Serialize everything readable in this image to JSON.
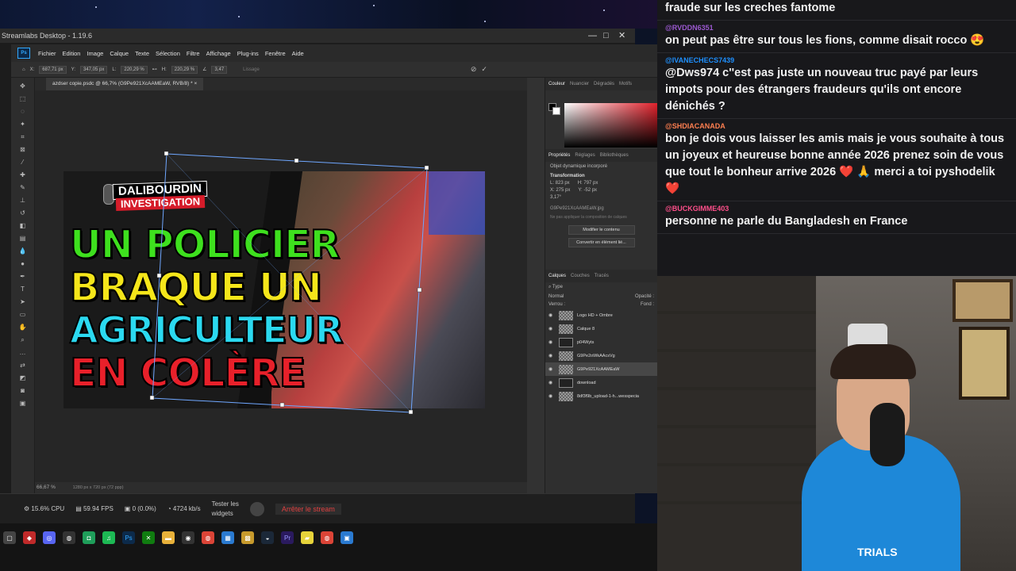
{
  "obs": {
    "title": "Streamlabs Desktop - 1.19.6",
    "min": "—",
    "max": "□",
    "close": "✕"
  },
  "ps": {
    "menu": [
      "Fichier",
      "Edition",
      "Image",
      "Calque",
      "Texte",
      "Sélection",
      "Filtre",
      "Affichage",
      "Plug-ins",
      "Fenêtre",
      "Aide"
    ],
    "options": {
      "x": "687,71 px",
      "y": "347,05 px",
      "w": "220,29 %",
      "h": "220,29 %",
      "angle": "3,47",
      "interp": "Lissage"
    },
    "doc_tab": "azdser copie.psdc @ 66,7% (G9Pe921XcAAMEaW, RVB/8) *",
    "zoom": "66,67 %",
    "doc_size": "1280 px x 720 px (72 ppp)",
    "thumbnail": {
      "badge_top": "DALIBOURDIN",
      "badge_bottom": "INVESTIGATION",
      "headline": [
        {
          "text": "UN POLICIER",
          "color": "#3ee01e"
        },
        {
          "text": "BRAQUE UN",
          "color": "#f5e61a"
        },
        {
          "text": "AGRICULTEUR",
          "color": "#2bd9f0"
        },
        {
          "text": "EN COLÈRE",
          "color": "#e8202a"
        }
      ]
    },
    "color_tabs": [
      "Couleur",
      "Nuancier",
      "Dégradés",
      "Motifs"
    ],
    "props_tabs": [
      "Propriétés",
      "Réglages",
      "Bibliothèques"
    ],
    "props": {
      "kind": "Objet dynamique incorporé",
      "transform": "Transformation",
      "L": "823 px",
      "H": "797 px",
      "X": "275 px",
      "Y": "-52 px",
      "angle": "3,17°",
      "filename": "G9Pe921XcAAMEaW.jpg",
      "comp": "Ne pas appliquer la composition de calques",
      "btn_edit": "Modifier le contenu",
      "btn_convert": "Convertir en élément lié..."
    },
    "layer_tabs": [
      "Calques",
      "Couches",
      "Tracés"
    ],
    "layer_search": "Type",
    "blend": "Normal",
    "opacity_label": "Opacité :",
    "lock_label": "Verrou :",
    "fill_label": "Fond :",
    "layers": [
      {
        "name": "Logo HD + Ombre",
        "dark": false,
        "sel": false
      },
      {
        "name": "Calque 8",
        "dark": false,
        "sel": false
      },
      {
        "name": "p04Wyts",
        "dark": true,
        "sel": false
      },
      {
        "name": "G9Pe2oWkAAcsVg",
        "dark": false,
        "sel": false
      },
      {
        "name": "G9Pe921XcAAMEaW",
        "dark": false,
        "sel": true
      },
      {
        "name": "download",
        "dark": true,
        "sel": false
      },
      {
        "name": "8df3f9b_upload-1-h...wesspecia",
        "dark": false,
        "sel": false
      }
    ]
  },
  "bottom": {
    "cpu": "15.6% CPU",
    "fps": "59.94 FPS",
    "dropped": "0 (0.0%)",
    "bitrate": "4724 kb/s",
    "test_widgets_1": "Tester les",
    "test_widgets_2": "widgets",
    "stop": "Arrêter le stream"
  },
  "chat": [
    {
      "user": "",
      "color": "#a970ff",
      "text": "fraude sur les creches fantome"
    },
    {
      "user": "@RVDDN6351",
      "color": "#9b59d0",
      "text": "on peut pas être sur tous les fions, comme disait rocco 😍"
    },
    {
      "user": "@IVANECHECS7439",
      "color": "#1e90ff",
      "text": "@Dws974 c''est pas juste un nouveau truc payé par leurs impots pour des étrangers fraudeurs qu'ils ont encore dénichés ?"
    },
    {
      "user": "@SHDIACANADA",
      "color": "#ff7f50",
      "text": "bon je dois vous laisser les amis mais je vous souhaite à tous un joyeux et heureuse bonne année 2026 prenez soin de vous que tout le bonheur arrive 2026 ❤️ 🙏 merci a toi pyshodelik ❤️"
    },
    {
      "user": "@BUCKGIMME403",
      "color": "#ff4f8b",
      "text": "personne ne parle du Bangladesh en France"
    }
  ],
  "webcam": {
    "shirt_text": "TRIALS"
  }
}
